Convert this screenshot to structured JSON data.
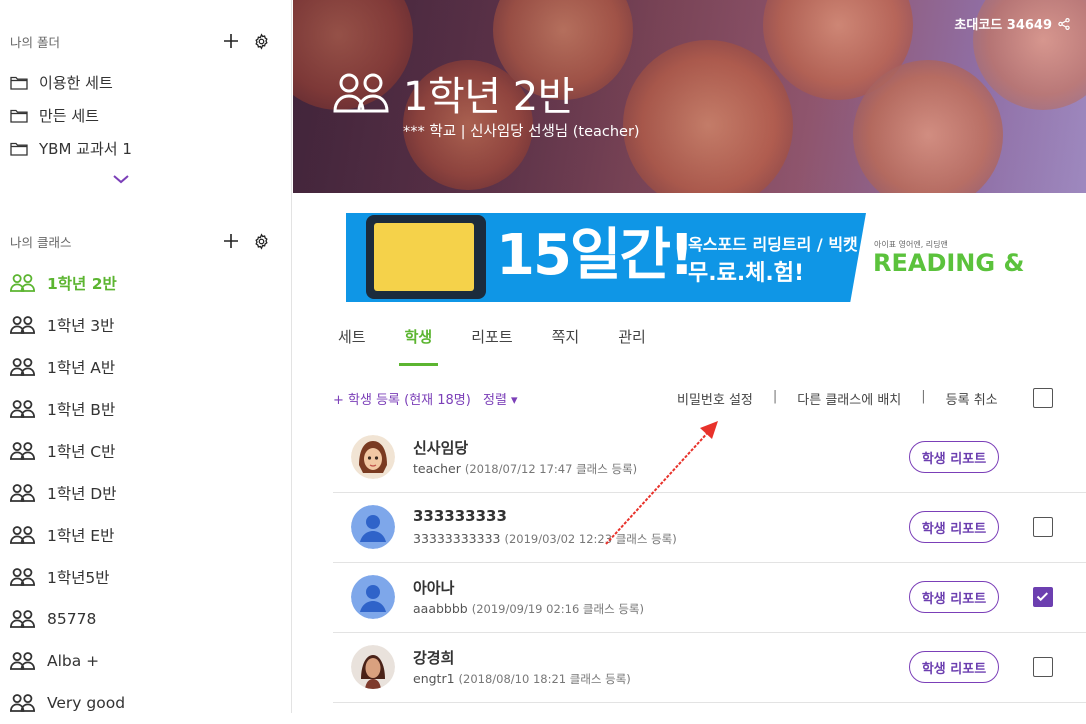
{
  "sidebar": {
    "folders_title": "나의 폴더",
    "folders": [
      {
        "label": "이용한 세트"
      },
      {
        "label": "만든 세트"
      },
      {
        "label": "YBM 교과서 1"
      }
    ],
    "classes_title": "나의 클래스",
    "classes": [
      {
        "label": "1학년 2반",
        "active": true
      },
      {
        "label": "1학년 3반"
      },
      {
        "label": "1학년 A반"
      },
      {
        "label": "1학년 B반"
      },
      {
        "label": "1학년 C반"
      },
      {
        "label": "1학년 D반"
      },
      {
        "label": "1학년 E반"
      },
      {
        "label": "1학년5반"
      },
      {
        "label": "85778"
      },
      {
        "label": "Alba +"
      },
      {
        "label": "Very good"
      }
    ],
    "icons": {
      "add": "plus-icon",
      "settings": "gear-icon",
      "folder": "folder-icon",
      "class": "group-icon",
      "expand": "chevron-down-icon"
    }
  },
  "header": {
    "invite_code": "초대코드 34649",
    "class_name": "1학년 2반",
    "subtitle": "*** 학교 | 신사임당 선생님  (teacher)"
  },
  "ad": {
    "big_text": "15일간!",
    "line1": "옥스포드 리딩트리 / 빅캣",
    "line2": "무.료.체.험!",
    "small": "아이표 영어엔, 리딩앤",
    "brand": "READING &"
  },
  "tabs": [
    {
      "label": "세트"
    },
    {
      "label": "학생",
      "active": true
    },
    {
      "label": "리포트"
    },
    {
      "label": "쪽지"
    },
    {
      "label": "관리"
    }
  ],
  "toolbar": {
    "add_student": "+ 학생 등록 (현재 18명)",
    "sort": "정렬 ▾",
    "set_password": "비밀번호 설정",
    "move_class": "다른 클래스에 배치",
    "cancel_register": "등록 취소",
    "separator": "|"
  },
  "students": [
    {
      "name": "신사임당",
      "id": "teacher",
      "date": "(2018/07/12 17:47 클래스 등록)",
      "report": "학생 리포트",
      "avatar": "teacher-avatar",
      "checkbox": false
    },
    {
      "name": "333333333",
      "id": "33333333333",
      "date": "(2019/03/02 12:23 클래스 등록)",
      "report": "학생 리포트",
      "avatar": "default-avatar",
      "checkbox": true,
      "checked": false
    },
    {
      "name": "아아나",
      "id": "aaabbbb",
      "date": "(2019/09/19 02:16 클래스 등록)",
      "report": "학생 리포트",
      "avatar": "default-avatar",
      "checkbox": true,
      "checked": true
    },
    {
      "name": "강경희",
      "id": "engtr1",
      "date": "(2018/08/10 18:21 클래스 등록)",
      "report": "학생 리포트",
      "avatar": "photo-avatar",
      "checkbox": true,
      "checked": false
    }
  ],
  "colors": {
    "accent_green": "#5cb531",
    "accent_purple": "#6c3fb0",
    "annotation_red": "#e8322b"
  }
}
